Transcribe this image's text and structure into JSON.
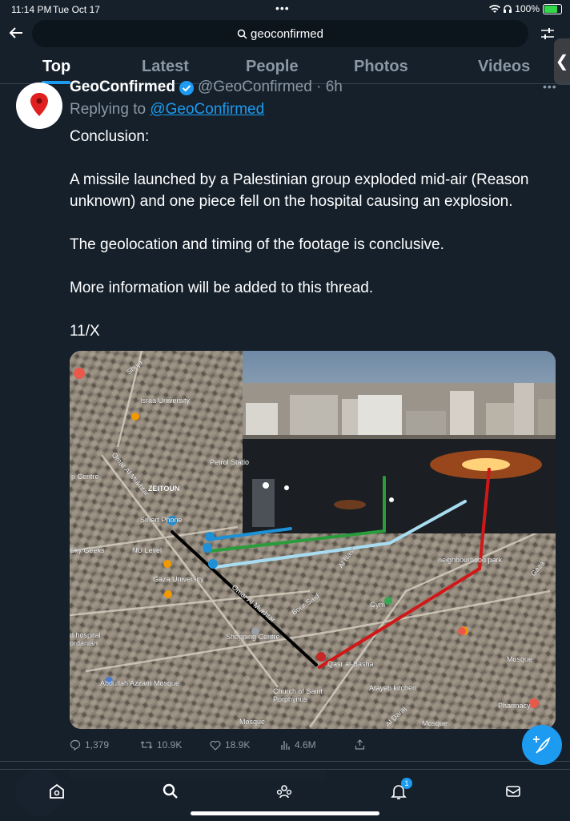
{
  "status_bar": {
    "time": "11:14 PM",
    "date": "Tue Oct 17",
    "battery": "100%",
    "dots": "•••"
  },
  "search": {
    "query": "geoconfirmed"
  },
  "tabs": [
    {
      "label": "Top",
      "active": true
    },
    {
      "label": "Latest"
    },
    {
      "label": "People"
    },
    {
      "label": "Photos"
    },
    {
      "label": "Videos"
    }
  ],
  "tweet": {
    "author_name": "GeoConfirmed",
    "handle_time": "@GeoConfirmed · 6h",
    "replying_prefix": "Replying to",
    "replying_to": "@GeoConfirmed",
    "paragraphs": [
      "Conclusion:",
      "A missile launched by a Palestinian group exploded mid-air (Reason unknown) and one piece fell on the hospital causing an explosion.",
      "The geolocation and timing of the footage is conclusive.",
      "More information will be added to this thread.",
      "11/X"
    ],
    "stats": {
      "replies": "1,379",
      "retweets": "10.9K",
      "likes": "18.9K",
      "views": "4.6M"
    }
  },
  "map_labels": {
    "shuja": "Shuja ...",
    "israa": "Israa University",
    "omar1": "Omar Al Mukhtar",
    "zeitoun": "ZEITOUN",
    "petrol": "Petrol Statio",
    "centre": "p Centre",
    "smartphone": "Smart Phone",
    "skygeeks": "Sky Geeks",
    "nulevel": "NU Level",
    "gazauniv": "Gaza University",
    "omar2": "Omar Al Mukhtar",
    "alnasr": "Al Nasr",
    "bourSaid": "Bour Said",
    "gym": "Gym",
    "hospital": "d hospital\nordanian",
    "shopping": "Shopping Centre",
    "qasrBasha": "Qasr al-Basha",
    "abdullah": "Abdullah Azzam Mosque",
    "church": "Church of Saint\nPorphyrius",
    "ataybe": "Atayeb kitchen",
    "mosque1": "Mosque",
    "mosque2": "Mosque",
    "mosque3": "Mosque",
    "pharmacy": "Pharmacy",
    "aldaraj": "Al Daraj",
    "neighbourhood": "neighbourhood park",
    "gazaright": "Gaza"
  },
  "notification_count": "1",
  "colors": {
    "accent": "#1d9bf0",
    "background": "#15202b"
  }
}
